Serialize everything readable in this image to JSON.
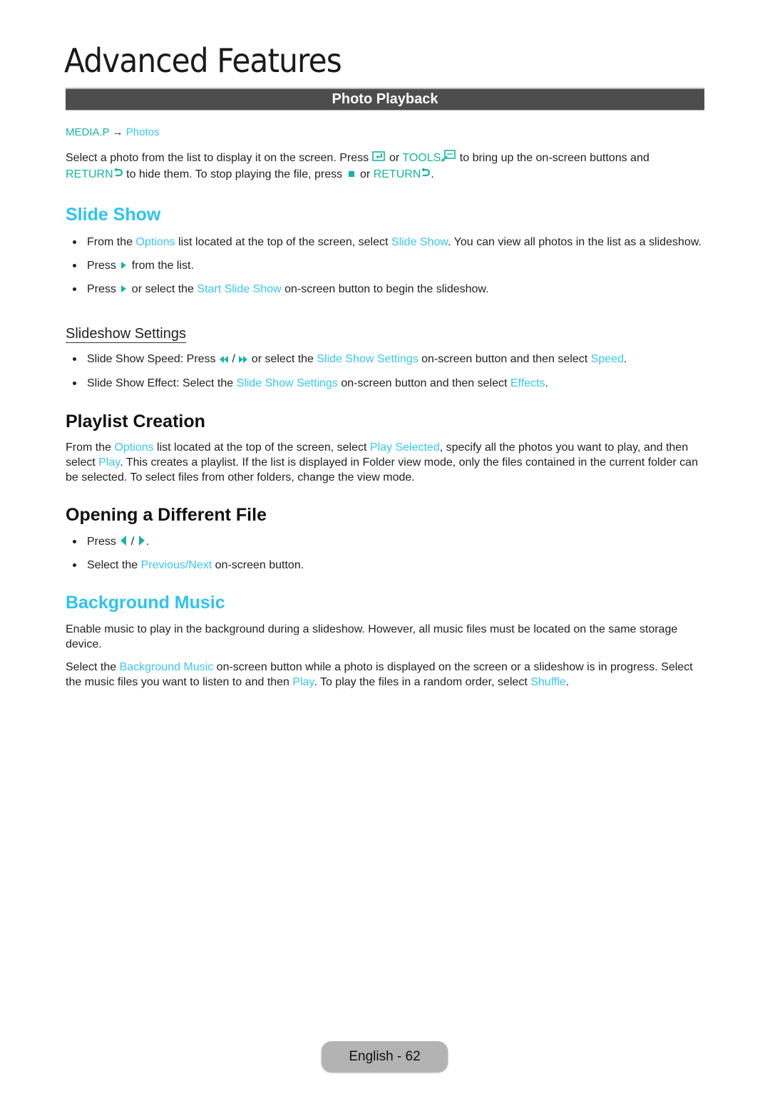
{
  "page": {
    "title": "Advanced Features",
    "section_bar": "Photo Playback",
    "breadcrumb": {
      "root": "MEDIA.P",
      "arrow": "→",
      "leaf": "Photos"
    },
    "intro": {
      "t1": "Select a photo from the list to display it on the screen. Press ",
      "t2": " or ",
      "tools": "TOOLS",
      "t3": " to bring up the on-screen buttons and ",
      "return1": "RETURN",
      "t4": " to hide them. To stop playing the file, press ",
      "t5": " or ",
      "return2": "RETURN",
      "t6": "."
    },
    "icons": {
      "enter": "enter-button-icon",
      "tools": "tools-button-icon",
      "return": "return-arrow-icon",
      "stop": "stop-icon",
      "play": "play-icon",
      "rewind": "rewind-icon",
      "fast_forward": "fast-forward-icon",
      "left": "left-arrow-icon",
      "right": "right-arrow-icon"
    },
    "accent_colors": {
      "teal": "#16b5a3",
      "cyan": "#39c6ef",
      "bar": "#4d4d4d"
    }
  },
  "slide_show": {
    "heading": "Slide Show",
    "b1": {
      "t1": "From the ",
      "l1": "Options",
      "t2": " list located at the top of the screen, select ",
      "l2": "Slide Show",
      "t3": ". You can view all photos in the list as a slideshow."
    },
    "b2": {
      "t1": "Press ",
      "t2": " from the list."
    },
    "b3": {
      "t1": "Press ",
      "t2": " or select the ",
      "l1": "Start Slide Show",
      "t3": " on-screen button to begin the slideshow."
    }
  },
  "slideshow_settings": {
    "heading": "Slideshow Settings",
    "b1": {
      "t1": "Slide Show Speed: Press ",
      "sep": " / ",
      "t2": " or select the ",
      "l1": "Slide Show Settings",
      "t3": " on-screen button and then select ",
      "l2": "Speed",
      "t4": "."
    },
    "b2": {
      "t1": "Slide Show Effect: Select the ",
      "l1": "Slide Show Settings",
      "t2": " on-screen button and then select ",
      "l2": "Effects",
      "t3": "."
    }
  },
  "playlist": {
    "heading": "Playlist Creation",
    "t1": "From the ",
    "l1": "Options",
    "t2": " list located at the top of the screen, select ",
    "l2": "Play Selected",
    "t3": ", specify all the photos you want to play, and then select ",
    "l3": "Play",
    "t4": ". This creates a playlist. If the list is displayed in Folder view mode, only the files contained in the current folder can be selected. To select files from other folders, change the view mode."
  },
  "opening": {
    "heading": "Opening a Different File",
    "b1": {
      "t1": "Press ",
      "sep": " / ",
      "t2": "."
    },
    "b2": {
      "t1": "Select the ",
      "l1": "Previous/Next",
      "t2": " on-screen button."
    }
  },
  "background_music": {
    "heading": "Background Music",
    "p1": "Enable music to play in the background during a slideshow. However, all music files must be located on the same storage device.",
    "p2": {
      "t1": "Select the ",
      "l1": "Background Music",
      "t2": " on-screen button while a photo is displayed on the screen or a slideshow is in progress. Select the music files you want to listen to and then ",
      "l2": "Play",
      "t3": ". To play the files in a random order, select ",
      "l3": "Shuffle",
      "t4": "."
    }
  },
  "footer": {
    "page_label": "English - 62"
  }
}
